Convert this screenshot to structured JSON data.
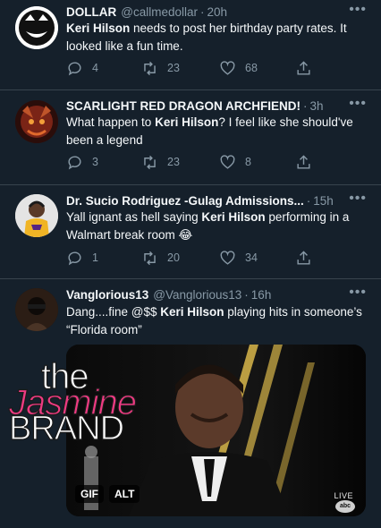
{
  "tweets": [
    {
      "name": "DOLLAR",
      "handle": "@callmedollar",
      "time": "20h",
      "text_parts": [
        {
          "t": "Keri Hilson",
          "b": true
        },
        {
          "t": " needs to post her birthday party rates. It looked like a fun time.",
          "b": false
        }
      ],
      "replies": "4",
      "retweets": "23",
      "likes": "68"
    },
    {
      "name": "SCARLIGHT RED DRAGON ARCHFIEND!",
      "handle": "",
      "time": "3h",
      "text_parts": [
        {
          "t": "What happen to ",
          "b": false
        },
        {
          "t": "Keri Hilson",
          "b": true
        },
        {
          "t": "? I feel like she should've been a legend",
          "b": false
        }
      ],
      "replies": "3",
      "retweets": "23",
      "likes": "8"
    },
    {
      "name": "Dr. Sucio Rodriguez -Gulag Admissions...",
      "handle": "",
      "time": "15h",
      "text_parts": [
        {
          "t": "Yall ignant as hell saying ",
          "b": false
        },
        {
          "t": "Keri Hilson",
          "b": true
        },
        {
          "t": " performing in a Walmart break room 😂",
          "b": false
        }
      ],
      "replies": "1",
      "retweets": "20",
      "likes": "34"
    },
    {
      "name": "Vanglorious13",
      "handle": "@Vanglorious13",
      "time": "16h",
      "text_parts": [
        {
          "t": "Dang....fine @$$ ",
          "b": false
        },
        {
          "t": "Keri Hilson",
          "b": true
        },
        {
          "t": " playing hits in someone’s “Florida room”",
          "b": false
        }
      ],
      "media": {
        "gif_label": "GIF",
        "alt_label": "ALT",
        "live_label": "LIVE",
        "network_label": "abc"
      }
    }
  ],
  "watermark": {
    "line1": "the",
    "line2": "Jasmine",
    "line3": "BRAND"
  },
  "icons": {
    "reply": "reply-icon",
    "retweet": "retweet-icon",
    "like": "heart-icon",
    "share": "share-icon",
    "more": "more-icon"
  },
  "colors": {
    "background": "#15202b",
    "secondary_text": "#8899a6",
    "divider": "#38444d",
    "watermark_pink": "#ee3b82"
  }
}
